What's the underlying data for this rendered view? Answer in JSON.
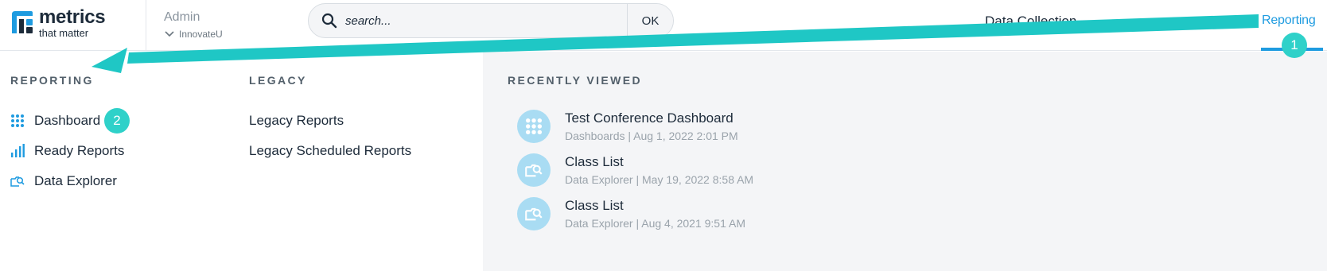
{
  "logo": {
    "title": "metrics",
    "subtitle": "that matter",
    "icon": "logo-mark-icon"
  },
  "tenant": {
    "role": "Admin",
    "org": "InnovateU"
  },
  "search": {
    "placeholder": "search...",
    "value": "",
    "button_label": "OK"
  },
  "nav": {
    "partial_label": "Data Collection",
    "active_label": "Reporting"
  },
  "annotations": {
    "step1": "1",
    "step2": "2"
  },
  "reporting": {
    "heading": "REPORTING",
    "items": [
      {
        "label": "Dashboard",
        "icon": "grid-dots-icon"
      },
      {
        "label": "Ready Reports",
        "icon": "bar-chart-icon"
      },
      {
        "label": "Data Explorer",
        "icon": "data-explorer-icon"
      }
    ]
  },
  "legacy": {
    "heading": "LEGACY",
    "items": [
      {
        "label": "Legacy Reports"
      },
      {
        "label": "Legacy Scheduled Reports"
      }
    ]
  },
  "recent": {
    "heading": "RECENTLY VIEWED",
    "items": [
      {
        "title": "Test Conference Dashboard",
        "meta": "Dashboards | Aug 1, 2022 2:01 PM",
        "icon": "grid-dots-icon"
      },
      {
        "title": "Class List",
        "meta": "Data Explorer | May 19, 2022 8:58 AM",
        "icon": "data-explorer-icon"
      },
      {
        "title": "Class List",
        "meta": "Data Explorer | Aug 4, 2021 9:51 AM",
        "icon": "data-explorer-icon"
      }
    ]
  },
  "colors": {
    "accent": "#1e9be0",
    "annotation": "#2fd1c9",
    "panel": "#f4f5f7",
    "text": "#1d2b3a"
  }
}
